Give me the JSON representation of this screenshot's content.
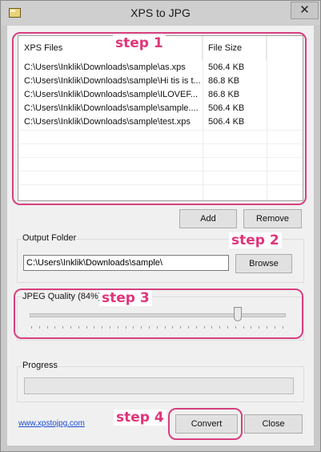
{
  "window": {
    "title": "XPS to JPG",
    "close_glyph": "✕"
  },
  "files": {
    "columns": [
      "XPS Files",
      "File Size"
    ],
    "rows": [
      {
        "name": "C:\\Users\\Inklik\\Downloads\\sample\\as.xps",
        "size": "506.4 KB"
      },
      {
        "name": "C:\\Users\\Inklik\\Downloads\\sample\\Hi tis is t...",
        "size": "86.8 KB"
      },
      {
        "name": "C:\\Users\\Inklik\\Downloads\\sample\\ILOVEF...",
        "size": "86.8 KB"
      },
      {
        "name": "C:\\Users\\Inklik\\Downloads\\sample\\sample....",
        "size": "506.4 KB"
      },
      {
        "name": "C:\\Users\\Inklik\\Downloads\\sample\\test.xps",
        "size": "506.4 KB"
      }
    ]
  },
  "buttons": {
    "add": "Add",
    "remove": "Remove",
    "browse": "Browse",
    "convert": "Convert",
    "close": "Close"
  },
  "output": {
    "label": "Output Folder",
    "value": "C:\\Users\\Inklik\\Downloads\\sample\\"
  },
  "quality": {
    "label": "JPEG Quality (84%)",
    "value_percent": 84
  },
  "progress": {
    "label": "Progress",
    "value_percent": 0
  },
  "link": "www.xpstojpg.com",
  "annotations": {
    "step1": "step 1",
    "step2": "step 2",
    "step3": "step 3",
    "step4": "step 4"
  },
  "colors": {
    "annotation": "#e0357a",
    "link": "#1a4dd6"
  }
}
